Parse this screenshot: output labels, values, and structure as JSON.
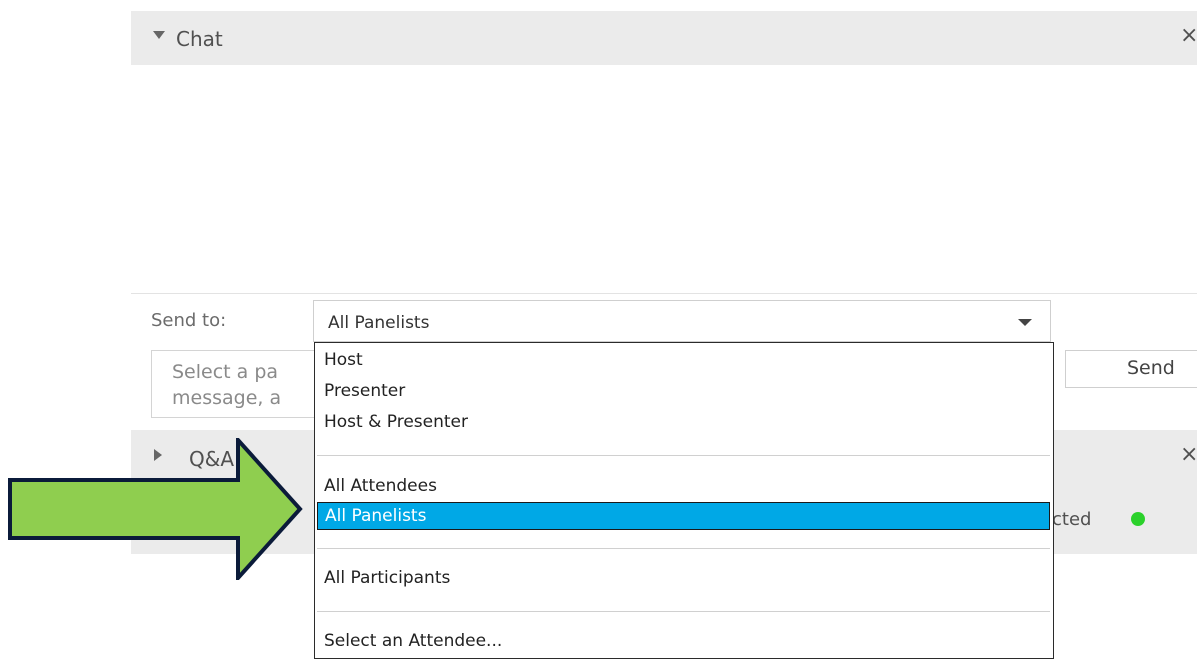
{
  "chat": {
    "title": "Chat",
    "close_glyph": "×",
    "expand_icon": "triangle-down-icon"
  },
  "send_to": {
    "label": "Send to:",
    "selected": "All Panelists"
  },
  "message": {
    "placeholder": "Select a pa\nmessage, a"
  },
  "send_button": {
    "label": "Send"
  },
  "qa": {
    "title": "Q&A",
    "close_glyph": "×",
    "expand_icon": "triangle-right-icon"
  },
  "status": {
    "text": "cted",
    "dot_color": "#2bd12b"
  },
  "dropdown": {
    "options": [
      "Host",
      "Presenter",
      "Host & Presenter",
      "All Attendees",
      "All Panelists",
      "All Participants",
      "Select an Attendee..."
    ],
    "selected_index": 4,
    "selected_color": "#00a8e6"
  },
  "annotation": {
    "arrow_color": "#8fce4f",
    "arrow_outline": "#0b1b3a",
    "icon": "arrow-right-icon"
  }
}
